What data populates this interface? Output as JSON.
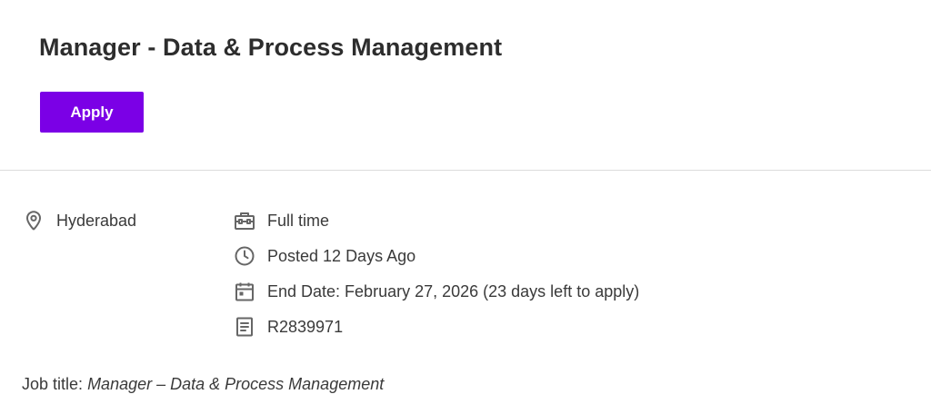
{
  "header": {
    "title": "Manager - Data & Process Management",
    "apply_label": "Apply",
    "accent_color": "#7b00e6"
  },
  "details": {
    "location": {
      "icon": "location-pin-icon",
      "text": "Hyderabad"
    },
    "employment_type": {
      "icon": "briefcase-icon",
      "text": "Full time"
    },
    "posted": {
      "icon": "clock-icon",
      "text": "Posted 12 Days Ago"
    },
    "end_date": {
      "icon": "calendar-icon",
      "text": "End Date: February 27, 2026 (23 days left to apply)"
    },
    "requisition_id": {
      "icon": "document-icon",
      "text": "R2839971"
    }
  },
  "description": {
    "job_title_label": "Job title",
    "job_title_separator": ": ",
    "job_title_value": "Manager – Data & Process Management"
  }
}
